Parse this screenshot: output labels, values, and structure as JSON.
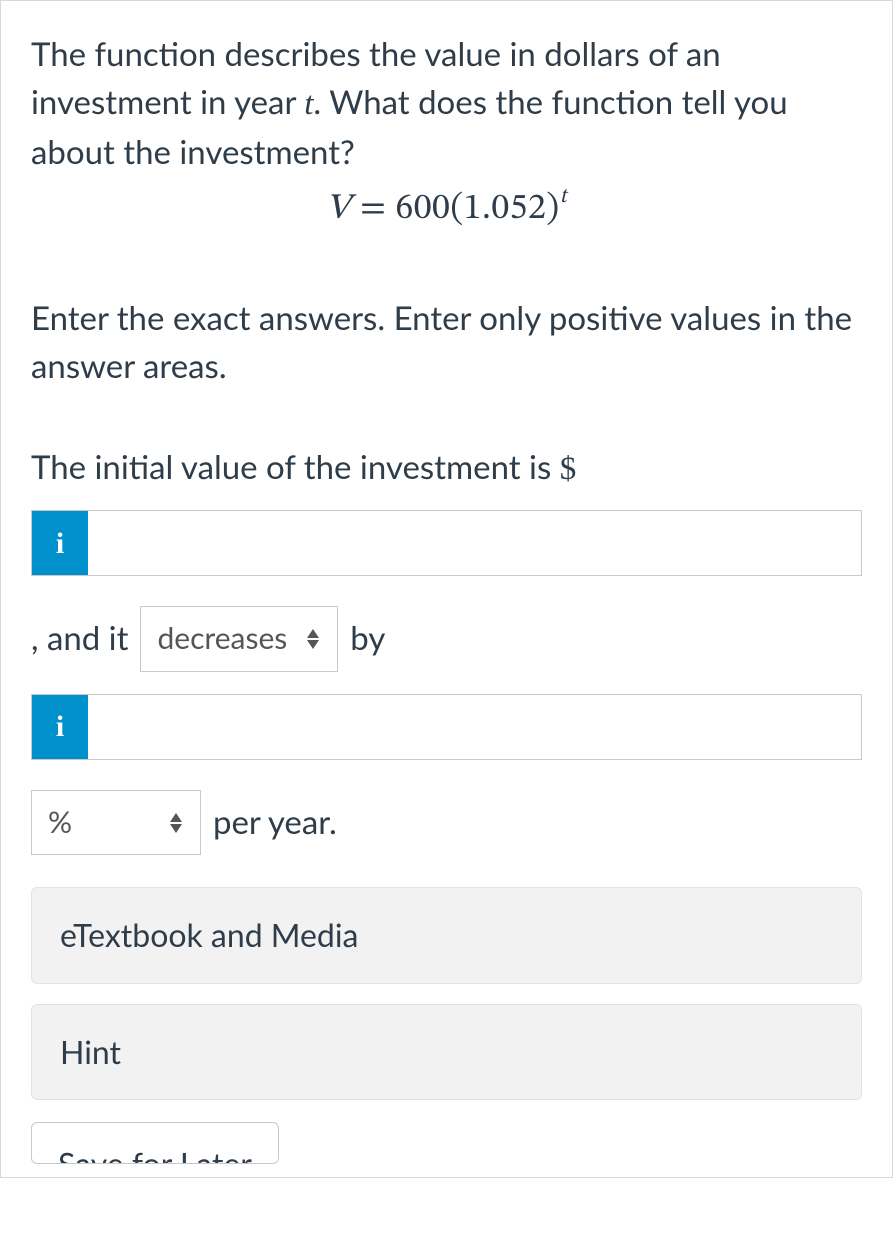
{
  "question": {
    "line1": "The function describes the value in dollars of an investment in year ",
    "var": "t",
    "line1b": ".  What does the function tell you about the investment?",
    "equation_lhs": "V",
    "equation_eq": " = ",
    "equation_rhs_base": "600(1.052)",
    "equation_rhs_exp": "t"
  },
  "instructions": "Enter the exact answers. Enter only positive values in the answer areas.",
  "answer": {
    "intro_a": "The initial value of the investment is ",
    "dollar": "$",
    "info_label": "i",
    "initial_value": "",
    "and_it": ", and it",
    "direction_selected": "decreases",
    "by": "by",
    "rate_value": "",
    "unit_selected": "%",
    "per_year": "per year."
  },
  "panels": {
    "etextbook": "eTextbook and Media",
    "hint": "Hint",
    "save_later": "Save for Later"
  }
}
